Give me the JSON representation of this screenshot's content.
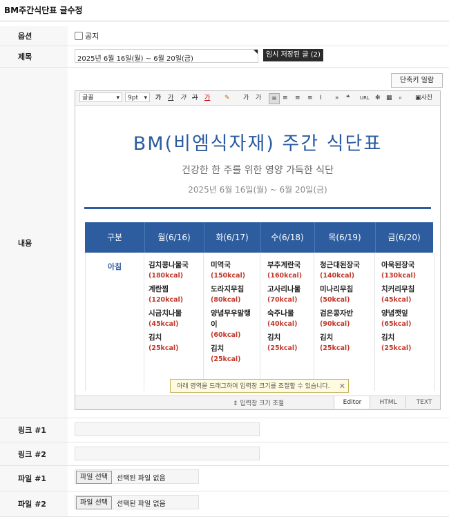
{
  "page": {
    "title": "BM주간식단표 글수정"
  },
  "form": {
    "options": {
      "label": "옵션",
      "notice_label": "공지"
    },
    "subject": {
      "label": "제목",
      "value": "2025년 6월 16일(월) ~ 6월 20일(금)",
      "draft_button": "임시 저장된 글 (2)"
    },
    "content": {
      "label": "내용",
      "shortcut_button": "단축키 일람"
    },
    "link1": {
      "label": "링크 #1"
    },
    "link2": {
      "label": "링크 #2"
    },
    "file1": {
      "label": "파일 #1",
      "button": "파일 선택",
      "status": "선택된 파일 없음"
    },
    "file2": {
      "label": "파일 #2",
      "button": "파일 선택",
      "status": "선택된 파일 없음"
    }
  },
  "toolbar": {
    "font": "글꼴",
    "size": "9pt",
    "photo": "사진"
  },
  "menu": {
    "title": "BM(비엠식자재) 주간 식단표",
    "subtitle": "건강한 한 주를 위한 영양 가득한 식단",
    "date": "2025년 6월 16일(월) ~ 6월 20일(금)",
    "headers": [
      "구분",
      "월(6/16)",
      "화(6/17)",
      "수(6/18)",
      "목(6/19)",
      "금(6/20)"
    ],
    "meal": "아침",
    "days": [
      [
        {
          "dish": "김치콩나물국",
          "kcal": "(180kcal)"
        },
        {
          "dish": "계란찜",
          "kcal": "(120kcal)"
        },
        {
          "dish": "시금치나물",
          "kcal": "(45kcal)"
        },
        {
          "dish": "김치",
          "kcal": "(25kcal)"
        }
      ],
      [
        {
          "dish": "미역국",
          "kcal": "(150kcal)"
        },
        {
          "dish": "도라지무침",
          "kcal": "(80kcal)"
        },
        {
          "dish": "양념무우말랭이",
          "kcal": "(60kcal)"
        },
        {
          "dish": "김치",
          "kcal": "(25kcal)"
        }
      ],
      [
        {
          "dish": "부추계란국",
          "kcal": "(160kcal)"
        },
        {
          "dish": "고사리나물",
          "kcal": "(70kcal)"
        },
        {
          "dish": "숙주나물",
          "kcal": "(40kcal)"
        },
        {
          "dish": "김치",
          "kcal": "(25kcal)"
        }
      ],
      [
        {
          "dish": "청근대된장국",
          "kcal": "(140kcal)"
        },
        {
          "dish": "미나리무침",
          "kcal": "(50kcal)"
        },
        {
          "dish": "검은콩자반",
          "kcal": "(90kcal)"
        },
        {
          "dish": "김치",
          "kcal": "(25kcal)"
        }
      ],
      [
        {
          "dish": "아욱된장국",
          "kcal": "(130kcal)"
        },
        {
          "dish": "치커리무침",
          "kcal": "(45kcal)"
        },
        {
          "dish": "양념깻잎",
          "kcal": "(65kcal)"
        },
        {
          "dish": "김치",
          "kcal": "(25kcal)"
        }
      ]
    ]
  },
  "editor": {
    "resize_tip": "아래 영역을 드래그하여 입력창 크기를 조절할 수 있습니다.",
    "resize_label": "입력창 크기 조절",
    "modes": [
      "Editor",
      "HTML",
      "TEXT"
    ]
  },
  "colors": {
    "header_blue": "#2d5d9f",
    "kcal_red": "#c0392b"
  }
}
